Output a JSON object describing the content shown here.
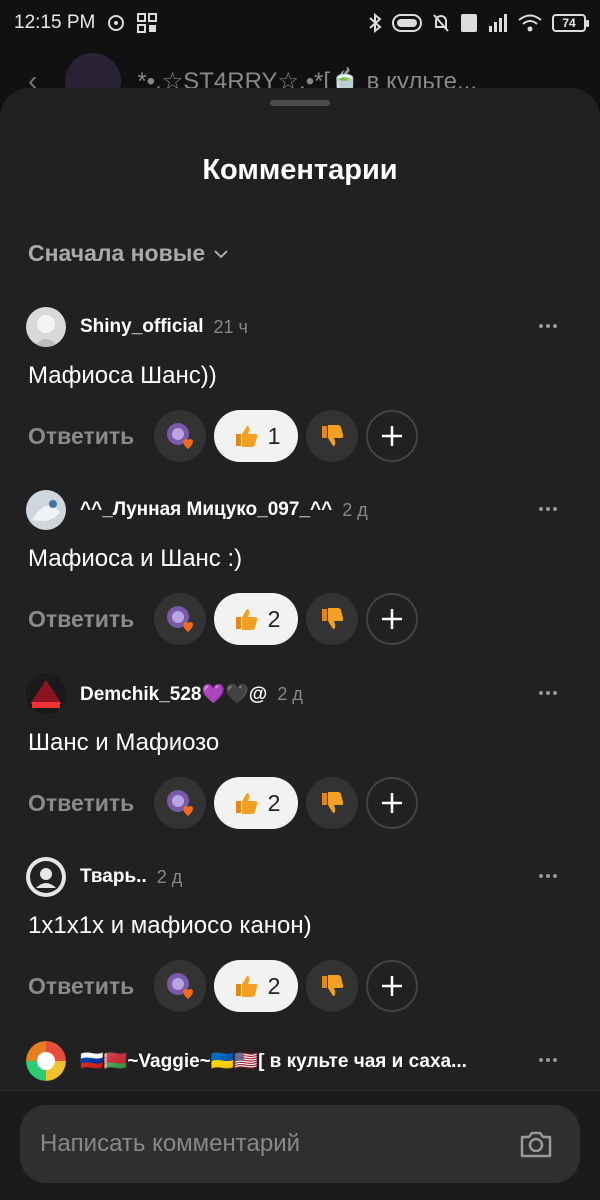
{
  "status_bar": {
    "time": "12:15 PM",
    "battery": "74"
  },
  "background_header": {
    "channel_title": "*•.☆ST4RRY☆.•*[🍵 в культе..."
  },
  "sheet": {
    "title": "Комментарии",
    "sort_label": "Сначала новые"
  },
  "comments": [
    {
      "author": "Shiny_official",
      "time": "21 ч",
      "text": "Мафиоса Шанс))",
      "reply_label": "Ответить",
      "likes": "1"
    },
    {
      "author": "^^_Лунная Мицуко_097_^^",
      "time": "2 д",
      "text": "Мафиоса и Шанс :)",
      "reply_label": "Ответить",
      "likes": "2"
    },
    {
      "author": "Demchik_528💜🖤@",
      "time": "2 д",
      "text": "Шанс и Мафиозо",
      "reply_label": "Ответить",
      "likes": "2"
    },
    {
      "author": "Тварь..",
      "time": "2 д",
      "text": "1x1x1x и мафиосо канон)",
      "reply_label": "Ответить",
      "likes": "2"
    },
    {
      "author": "🇷🇺🇧🇾~Vaggie~🇺🇦🇺🇸[ в культе чая и саха...",
      "time": ""
    }
  ],
  "composer": {
    "placeholder": "Написать комментарий"
  },
  "colors": {
    "sheet_bg": "#212121",
    "pill_light": "#f2f2f2",
    "thumb": "#f2a024"
  }
}
